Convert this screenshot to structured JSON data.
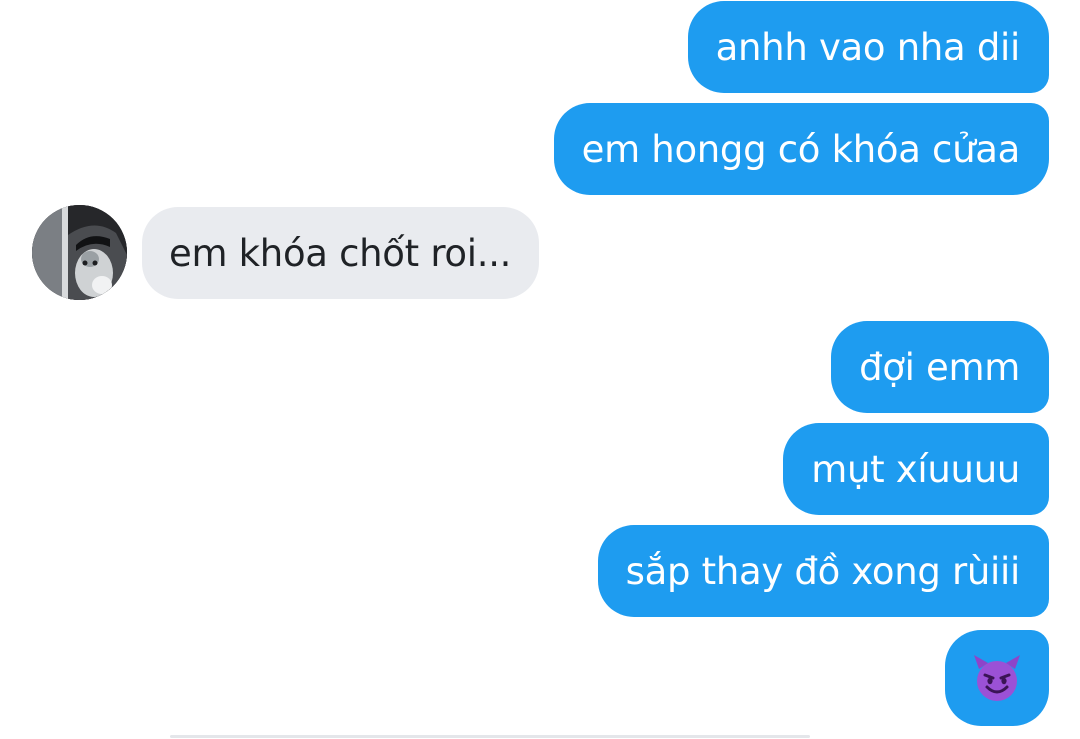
{
  "conversation": {
    "messages": [
      {
        "sender": "me",
        "text": "anhh vao nha dii"
      },
      {
        "sender": "me",
        "text": "em hongg có khóa cửaa"
      },
      {
        "sender": "other",
        "text": "em khóa chốt roi..."
      },
      {
        "sender": "me",
        "text": "đợi emm"
      },
      {
        "sender": "me",
        "text": "mụt xíuuuu"
      },
      {
        "sender": "me",
        "text": "sắp thay đồ xong rùiii"
      },
      {
        "sender": "me",
        "text": "😈",
        "type": "emoji"
      }
    ]
  },
  "contact": {
    "avatar_icon": "profile-photo"
  },
  "colors": {
    "sent_bubble": "#1e9cf0",
    "received_bubble": "#e9ebef",
    "sent_text": "#ffffff",
    "received_text": "#1f2226",
    "background": "#ffffff"
  }
}
